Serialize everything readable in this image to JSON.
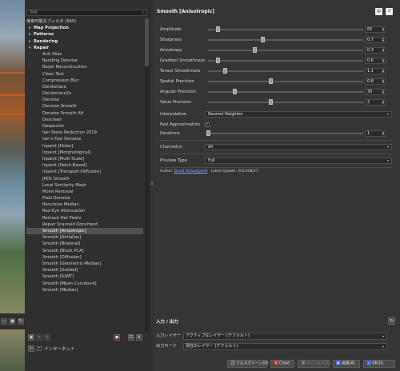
{
  "filters": {
    "search_placeholder": "検索",
    "items": [
      {
        "label": "使用可能なフィルタ (565)",
        "kind": "header"
      },
      {
        "label": "Map Projection",
        "kind": "cat",
        "tw": "▸"
      },
      {
        "label": "Patterns",
        "kind": "cat",
        "tw": "▸"
      },
      {
        "label": "Rendering",
        "kind": "cat",
        "tw": "▸"
      },
      {
        "label": "Repair",
        "kind": "cat",
        "tw": "▾"
      },
      {
        "label": "Anti Alias",
        "kind": "item"
      },
      {
        "label": "Banding Denoise",
        "kind": "item"
      },
      {
        "label": "Bayer Reconstruction",
        "kind": "item"
      },
      {
        "label": "Clean Text",
        "kind": "item"
      },
      {
        "label": "Compression Blur",
        "kind": "item"
      },
      {
        "label": "Deinterlace",
        "kind": "item"
      },
      {
        "label": "Deinterlace2x",
        "kind": "item"
      },
      {
        "label": "Denoise",
        "kind": "item"
      },
      {
        "label": "Denoise Smooth",
        "kind": "item"
      },
      {
        "label": "Denoise Smooth Alt",
        "kind": "item"
      },
      {
        "label": "Descreen",
        "kind": "item"
      },
      {
        "label": "Despeckle",
        "kind": "item"
      },
      {
        "label": "Iain Noise Reduction 2019",
        "kind": "item"
      },
      {
        "label": "Iain's Fast Denoise",
        "kind": "item"
      },
      {
        "label": "Inpaint [Holes]",
        "kind": "item"
      },
      {
        "label": "Inpaint [Morphological]",
        "kind": "item"
      },
      {
        "label": "Inpaint [Multi-Scale]",
        "kind": "item"
      },
      {
        "label": "Inpaint [Patch-Based]",
        "kind": "item"
      },
      {
        "label": "Inpaint [Transport-Diffusion]",
        "kind": "item"
      },
      {
        "label": "JPEG Smooth",
        "kind": "item"
      },
      {
        "label": "Local Similarity Mask",
        "kind": "item"
      },
      {
        "label": "Moire Removal",
        "kind": "item"
      },
      {
        "label": "Pixel Denoise",
        "kind": "item"
      },
      {
        "label": "Recursive Median",
        "kind": "item"
      },
      {
        "label": "Red-Eye Attenuation",
        "kind": "item"
      },
      {
        "label": "Remove Hot Pixels",
        "kind": "item"
      },
      {
        "label": "Repair Scanned Document",
        "kind": "item"
      },
      {
        "label": "Smooth [Anisotropic]",
        "kind": "item",
        "selected": true
      },
      {
        "label": "Smooth [Antialias]",
        "kind": "item"
      },
      {
        "label": "Smooth [Bilateral]",
        "kind": "item"
      },
      {
        "label": "Smooth [Block PCA]",
        "kind": "item"
      },
      {
        "label": "Smooth [Diffusion]",
        "kind": "item"
      },
      {
        "label": "Smooth [Geometric-Median]",
        "kind": "item"
      },
      {
        "label": "Smooth [Guided]",
        "kind": "item"
      },
      {
        "label": "Smooth [IUWT]",
        "kind": "item"
      },
      {
        "label": "Smooth [Mean-Curvature]",
        "kind": "item"
      },
      {
        "label": "Smooth [Median]",
        "kind": "item"
      }
    ],
    "internet_label": "インターネット"
  },
  "settings": {
    "title": "Smooth [Anisotropic]",
    "params": [
      {
        "label": "Amplitude",
        "value": "60",
        "fraction": 0.06
      },
      {
        "label": "Sharpness",
        "value": "0.7",
        "fraction": 0.35
      },
      {
        "label": "Anisotropy",
        "value": "0.3",
        "fraction": 0.3
      },
      {
        "label": "Gradient Smoothness",
        "value": "0.6",
        "fraction": 0.06
      },
      {
        "label": "Tensor Smoothness",
        "value": "1.1",
        "fraction": 0.11
      },
      {
        "label": "Spatial Precision",
        "value": "0.8",
        "fraction": 0.4
      },
      {
        "label": "Angular Precision",
        "value": "30",
        "fraction": 0.17
      },
      {
        "label": "Value Precision",
        "value": "2",
        "fraction": 0.4
      }
    ],
    "interpolation_label": "Interpolation",
    "interpolation_value": "Nearest Neighbor",
    "fast_approx_label": "Fast Approximation",
    "iterations_label": "Iterations",
    "iterations_value": "1",
    "iterations_fraction": 0.0,
    "channels_label": "Channel(s)",
    "channels_value": "All",
    "preview_label": "Preview Type",
    "preview_value": "Full",
    "author_prefix": "Author:",
    "author_name": "David Tschumperlé",
    "latest_update": "Latest Update: 2013/08/27."
  },
  "io": {
    "title": "入力 / 出力",
    "input_label": "入力レイヤー",
    "input_value": "アクティブなレイヤー (デフォルト)",
    "output_label": "出力モード",
    "output_value": "現在のレイヤー (デフォルト)"
  },
  "buttons": {
    "fullscreen": "フルスクリーン(U)",
    "close": "Close",
    "cancel": "キャンセル(C)",
    "apply": "適用(A)",
    "ok": "OK(O)"
  },
  "colors": {
    "accent": "#7fb2ff",
    "selection": "#525252",
    "close_icon": "#c23b2b",
    "apply_icon": "#3c6dd8"
  }
}
